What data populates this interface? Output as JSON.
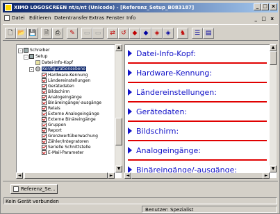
{
  "app": {
    "title": "XIMO LOGOSCREEN nt/s/nt (Unicode) - [Referenz_Setup_B083187]"
  },
  "menu": {
    "items": [
      "Datei",
      "Editieren",
      "Datentransfer",
      "Extras",
      "Fenster",
      "Info"
    ],
    "mdi_controls": "_ □ x"
  },
  "window_controls": {
    "minimize": "_",
    "maximize": "□",
    "close": "x"
  },
  "toolbar": {
    "buttons": [
      {
        "name": "new-icon",
        "glyph": "🗋"
      },
      {
        "name": "open-icon",
        "glyph": "📂"
      },
      {
        "name": "save-icon",
        "glyph": "💾"
      },
      {
        "name": "print-preview-icon",
        "glyph": "🗎"
      },
      {
        "name": "print-icon",
        "glyph": "⎙"
      },
      {
        "name": "tools-icon",
        "glyph": "✎"
      },
      {
        "name": "disabled-icon-1",
        "glyph": "▭"
      },
      {
        "name": "disabled-icon-2",
        "glyph": "▭"
      },
      {
        "name": "transfer-icon-1",
        "glyph": "⇄"
      },
      {
        "name": "transfer-icon-2",
        "glyph": "↺"
      },
      {
        "name": "transfer-icon-3",
        "glyph": "◆"
      },
      {
        "name": "transfer-icon-4",
        "glyph": "◆"
      },
      {
        "name": "transfer-icon-5",
        "glyph": "◈"
      },
      {
        "name": "transfer-icon-6",
        "glyph": "◈"
      },
      {
        "name": "user-icon",
        "glyph": "♞"
      },
      {
        "name": "list-icon",
        "glyph": "☰"
      },
      {
        "name": "window-icon",
        "glyph": "▤"
      }
    ]
  },
  "tree": {
    "root": "Schreiber",
    "setup": "Setup",
    "datei_info": "Datei-Info-Kopf",
    "config": "Konfigurationsebene",
    "items": [
      "Hardware-Kennung",
      "Ländereinstellungen",
      "Gerätedaten",
      "Bildschirm",
      "Analogeingänge",
      "Binäreingänge/-ausgänge",
      "Relais",
      "Externe Analogeingänge",
      "Externe Binäreingänge",
      "Gruppen",
      "Report",
      "Grenzwertüberwachung",
      "Zähler/Integratoren",
      "Serielle Schnittstelle",
      "E-Mail-Parameter"
    ]
  },
  "content": {
    "sections": [
      "Datei-Info-Kopf:",
      "Hardware-Kennung:",
      "Ländereinstellungen:",
      "Gerätedaten:",
      "Bildschirm:",
      "Analogeingänge:",
      "Binäreingänge/-ausgänge:"
    ]
  },
  "scroll": {
    "up": "▲",
    "down": "▼",
    "left": "◄",
    "right": "►"
  },
  "tree_toggles": {
    "expand": "-"
  },
  "doctab": {
    "label": "Referenz_Se..."
  },
  "status": {
    "message": "Kein Gerät verbunden",
    "user": "Benutzer: Spezialist"
  }
}
